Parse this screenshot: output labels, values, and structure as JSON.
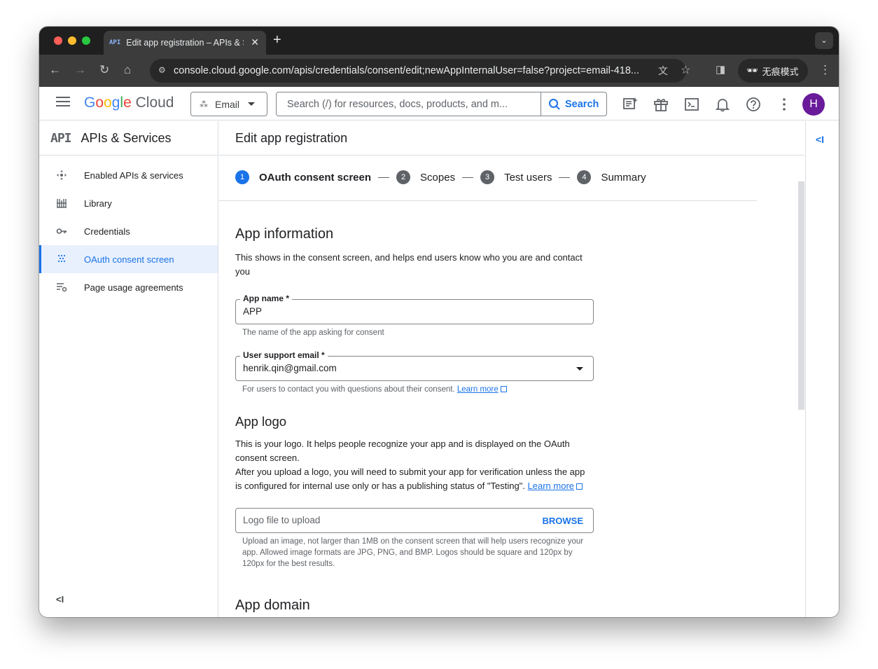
{
  "browser": {
    "tab_favicon": "API",
    "tab_title": "Edit app registration – APIs & Services",
    "tab_close": "✕",
    "new_tab": "+",
    "url": "console.cloud.google.com/apis/credentials/consent/edit;newAppInternalUser=false?project=email-418...",
    "incognito_label": "无痕模式"
  },
  "header": {
    "logo_google": "Google",
    "logo_cloud": "Cloud",
    "project": "Email",
    "search_placeholder": "Search (/) for resources, docs, products, and m...",
    "search_button": "Search",
    "avatar_initial": "H"
  },
  "sidebar": {
    "product_icon": "API",
    "product_title": "APIs & Services",
    "items": [
      {
        "label": "Enabled APIs & services",
        "icon": "enabled-apis-icon"
      },
      {
        "label": "Library",
        "icon": "library-icon"
      },
      {
        "label": "Credentials",
        "icon": "key-icon"
      },
      {
        "label": "OAuth consent screen",
        "icon": "consent-icon",
        "active": true
      },
      {
        "label": "Page usage agreements",
        "icon": "agreements-icon"
      }
    ],
    "collapse_label": "<I"
  },
  "main": {
    "page_title": "Edit app registration",
    "steps": [
      {
        "num": "1",
        "label": "OAuth consent screen"
      },
      {
        "num": "2",
        "label": "Scopes"
      },
      {
        "num": "3",
        "label": "Test users"
      },
      {
        "num": "4",
        "label": "Summary"
      }
    ],
    "app_info": {
      "title": "App information",
      "desc": "This shows in the consent screen, and helps end users know who you are and contact you",
      "app_name_label": "App name *",
      "app_name_value": "APP",
      "app_name_hint": "The name of the app asking for consent",
      "email_label": "User support email *",
      "email_value": "henrik.qin@gmail.com",
      "email_hint": "For users to contact you with questions about their consent.",
      "learn_more": "Learn more"
    },
    "app_logo": {
      "title": "App logo",
      "desc1": "This is your logo. It helps people recognize your app and is displayed on the OAuth consent screen.",
      "desc2": "After you upload a logo, you will need to submit your app for verification unless the app is configured for internal use only or has a publishing status of \"Testing\".",
      "learn_more": "Learn more",
      "upload_placeholder": "Logo file to upload",
      "browse": "BROWSE",
      "upload_hint": "Upload an image, not larger than 1MB on the consent screen that will help users recognize your app. Allowed image formats are JPG, PNG, and BMP. Logos should be square and 120px by 120px for the best results."
    },
    "app_domain": {
      "title": "App domain"
    }
  },
  "right_panel": {
    "collapse_label": "<I"
  },
  "colors": {
    "accent": "#1a73e8",
    "active_bg": "#e8f0fe",
    "avatar": "#6a1b9a"
  }
}
